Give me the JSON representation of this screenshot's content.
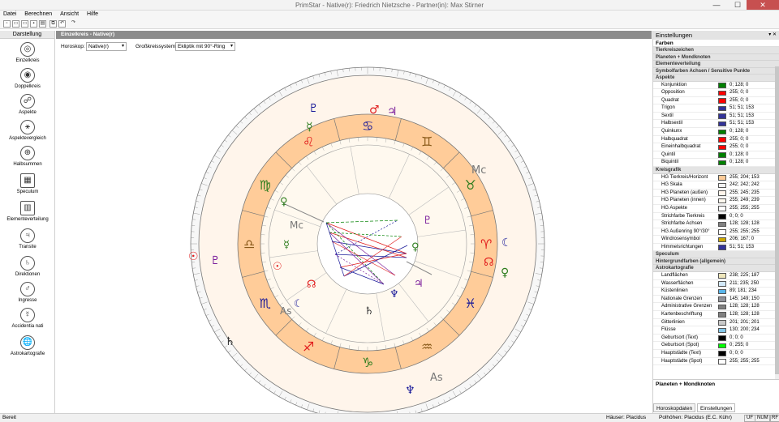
{
  "window": {
    "title": "PrimStar - Native(r): Friedrich Nietzsche - Partner(in): Max Stirner",
    "minimize": "—",
    "maximize": "☐",
    "close": "✕"
  },
  "menu": [
    "Datei",
    "Berechnen",
    "Ansicht",
    "Hilfe"
  ],
  "left_panel": {
    "header": "Darstellung",
    "items": [
      {
        "label": "Einzelkreis",
        "icon": "single-circle-icon",
        "glyph": "◎"
      },
      {
        "label": "Doppelkreis",
        "icon": "double-circle-icon",
        "glyph": "◉"
      },
      {
        "label": "Aspekte",
        "icon": "aspects-icon",
        "glyph": "☍"
      },
      {
        "label": "Aspektevergleich",
        "icon": "aspect-compare-icon",
        "glyph": "⚹"
      },
      {
        "label": "Halbsummen",
        "icon": "midpoints-icon",
        "glyph": "⊕"
      },
      {
        "label": "Speculum",
        "icon": "speculum-icon",
        "glyph": "▦"
      },
      {
        "label": "Elementeverteilung",
        "icon": "element-distribution-icon",
        "glyph": "▥"
      },
      {
        "label": "Transite",
        "icon": "transits-icon",
        "glyph": "♃"
      },
      {
        "label": "Direktionen",
        "icon": "directions-icon",
        "glyph": "♄"
      },
      {
        "label": "Ingresse",
        "icon": "ingress-icon",
        "glyph": "♂"
      },
      {
        "label": "Accidentia nati",
        "icon": "accidentia-icon",
        "glyph": "☿"
      },
      {
        "label": "Astrokartografie",
        "icon": "astrocartography-icon",
        "glyph": "🌐"
      }
    ]
  },
  "doc": {
    "tab": "Einzelkreis - Native(r)",
    "horoskop_label": "Horoskop:",
    "horoskop_value": "Native(r)",
    "grosskreis_label": "Großkreissystem:",
    "grosskreis_value": "Ekliptik mit 90°-Ring"
  },
  "chart_labels": {
    "mc_outer": "Mc",
    "mc_inner": "Mc",
    "as_inner": "As",
    "as_outer": "As"
  },
  "signs": [
    "♈",
    "♉",
    "♊",
    "♋",
    "♌",
    "♍",
    "♎",
    "♏",
    "♐",
    "♑",
    "♒",
    "♓"
  ],
  "colors": {
    "zodiac_band": "#ffcc99",
    "planet_bg_outer": "#fff5eb",
    "planet_bg_inner": "#fff9ef",
    "fire": "#e11d1d",
    "earth": "#2e7d1e",
    "air": "#8a5a1a",
    "water": "#1a1a99",
    "accent_blue": "#1a1a99",
    "accent_purple": "#7a1a9a"
  },
  "right_panel": {
    "title": "Einstellungen",
    "pins": "▾ ✕",
    "sub": "Farben",
    "collapsed_sections": [
      "Tierkreiszeichen",
      "Planeten + Mondknoten",
      "Elementeverteilung",
      "Symbolfarben Achsen / Sensitive Punkte"
    ],
    "aspects_title": "Aspekte",
    "aspects": [
      {
        "name": "Konjunktion",
        "color": "#008000",
        "value": "0; 128; 0"
      },
      {
        "name": "Opposition",
        "color": "#ff0000",
        "value": "255; 0; 0"
      },
      {
        "name": "Quadrat",
        "color": "#ff0000",
        "value": "255; 0; 0"
      },
      {
        "name": "Trigon",
        "color": "#333399",
        "value": "51; 51; 153"
      },
      {
        "name": "Sextil",
        "color": "#333399",
        "value": "51; 51; 153"
      },
      {
        "name": "Halbsextil",
        "color": "#333399",
        "value": "51; 51; 153"
      },
      {
        "name": "Quinkunx",
        "color": "#008000",
        "value": "0; 128; 0"
      },
      {
        "name": "Halbquadrat",
        "color": "#ff0000",
        "value": "255; 0; 0"
      },
      {
        "name": "Eineinhalbquadrat",
        "color": "#ff0000",
        "value": "255; 0; 0"
      },
      {
        "name": "Quintil",
        "color": "#008000",
        "value": "0; 128; 0"
      },
      {
        "name": "Biquintil",
        "color": "#008000",
        "value": "0; 128; 0"
      }
    ],
    "kreis_title": "Kreisgrafik",
    "kreis": [
      {
        "name": "HG Tierkreis/Horizont",
        "color": "#ffcc99",
        "value": "255; 204; 153"
      },
      {
        "name": "HG Skala",
        "color": "#f2f2f2",
        "value": "242; 242; 242"
      },
      {
        "name": "HG Planeten (außen)",
        "color": "#fff5eb",
        "value": "255; 245; 235"
      },
      {
        "name": "HG Planeten (innen)",
        "color": "#fff9ef",
        "value": "255; 249; 239"
      },
      {
        "name": "HG Aspekte",
        "color": "#ffffff",
        "value": "255; 255; 255"
      },
      {
        "name": "Strichfarbe Tierkreis",
        "color": "#000000",
        "value": "0; 0; 0"
      },
      {
        "name": "Strichfarbe Achsen",
        "color": "#808080",
        "value": "128; 128; 128"
      },
      {
        "name": "HG Außenring 90°/30°",
        "color": "#ffffff",
        "value": "255; 255; 255"
      },
      {
        "name": "Windrosensymbol",
        "color": "#cca700",
        "value": "206; 167; 0"
      },
      {
        "name": "Himmelsrichtungen",
        "color": "#333399",
        "value": "51; 51; 153"
      }
    ],
    "mid_sections": [
      "Speculum",
      "Hintergrundfarben (allgemein)"
    ],
    "astro_title": "Astrokartografie",
    "astro": [
      {
        "name": "Landflächen",
        "color": "#eee6bb",
        "value": "238; 225; 187"
      },
      {
        "name": "Wasserflächen",
        "color": "#d3e9fa",
        "value": "211; 235; 250"
      },
      {
        "name": "Küstenlinien",
        "color": "#59b5ea",
        "value": "89; 181; 234"
      },
      {
        "name": "Nationale Grenzen",
        "color": "#91939a",
        "value": "145; 149; 150"
      },
      {
        "name": "Administrative Grenzen",
        "color": "#808080",
        "value": "128; 128; 128"
      },
      {
        "name": "Kartenbeschriftung",
        "color": "#808080",
        "value": "128; 128; 128"
      },
      {
        "name": "Gitterlinien",
        "color": "#c9c9c9",
        "value": "201; 201; 201"
      },
      {
        "name": "Flüsse",
        "color": "#84c8ea",
        "value": "130; 200; 234"
      },
      {
        "name": "Geburtsort (Text)",
        "color": "#000000",
        "value": "0; 0; 0"
      },
      {
        "name": "Geburtsort (Spot)",
        "color": "#00ff00",
        "value": "0; 255; 0"
      },
      {
        "name": "Hauptstädte (Text)",
        "color": "#000000",
        "value": "0; 0; 0"
      },
      {
        "name": "Hauptstädte (Spot)",
        "color": "#ffffff",
        "value": "255; 255; 255"
      }
    ],
    "footer_title": "Planeten + Mondknoten",
    "tabs": [
      "Horoskopdaten",
      "Einstellungen"
    ]
  },
  "status": {
    "left": "Bereit",
    "houses": "Häuser: Placidus",
    "poles": "Polhöhen: Placidus (E.C. Kühr)",
    "uf": "UF",
    "num": "NUM",
    "rf": "RF"
  }
}
